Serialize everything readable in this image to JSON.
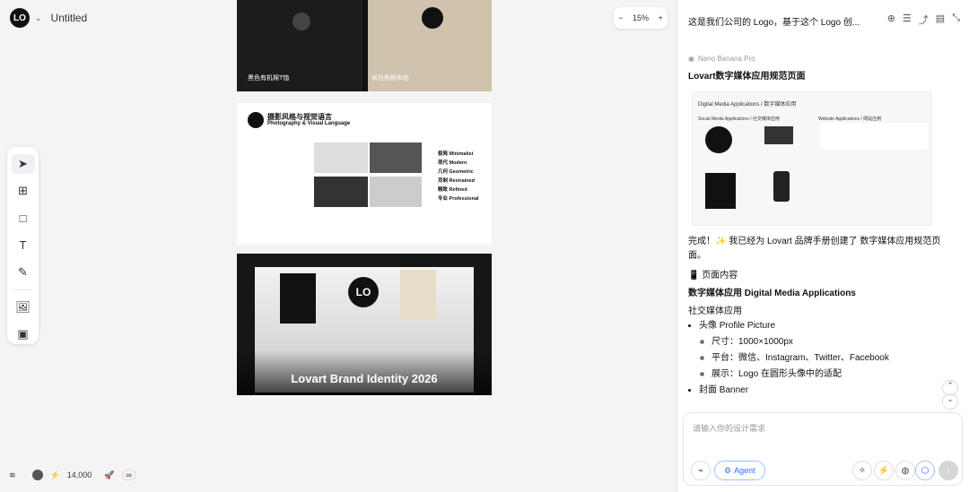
{
  "app": {
    "title": "Untitled",
    "logo": "LO"
  },
  "zoom": "15%",
  "credits": "14,000",
  "panel": {
    "header": "这是我们公司的 Logo，基于这个 Logo 创...",
    "model": "Nano Banana Pro",
    "heading": "Lovart数字媒体应用规范页面",
    "done": "完成！✨ 我已经为 Lovart 品牌手册创建了 数字媒体应用规范页面。",
    "sec1": "📱 页面内容",
    "sec2": "数字媒体应用 Digital Media Applications",
    "sec3": "社交媒体应用",
    "li1": "头像 Profile Picture",
    "li1a": "尺寸：1000×1000px",
    "li1b": "平台：微信、Instagram、Twitter、Facebook",
    "li1c": "展示：Logo 在圆形头像中的适配",
    "li2": "封面 Banner",
    "placeholder": "请输入你的设计需求",
    "agent": "Agent"
  },
  "canvas": {
    "cap1": "黑色有机棉T恤",
    "cap2": "米白色帆布包",
    "sheet_title": "摄影风格与视觉语言",
    "sheet_sub": "Photography & Visual Language",
    "keywords": [
      "极简 Minimalist",
      "现代 Modern",
      "几何 Geometric",
      "克制 Restrained",
      "精致 Refined",
      "专业 Professional"
    ],
    "brand": "Lovart Brand Identity 2026",
    "mini_title": "Digital Media Applications / 数字媒体应用",
    "mini_left": "Social Media Applications / 社交媒体应用",
    "mini_right": "Website Applications / 网站应用"
  }
}
